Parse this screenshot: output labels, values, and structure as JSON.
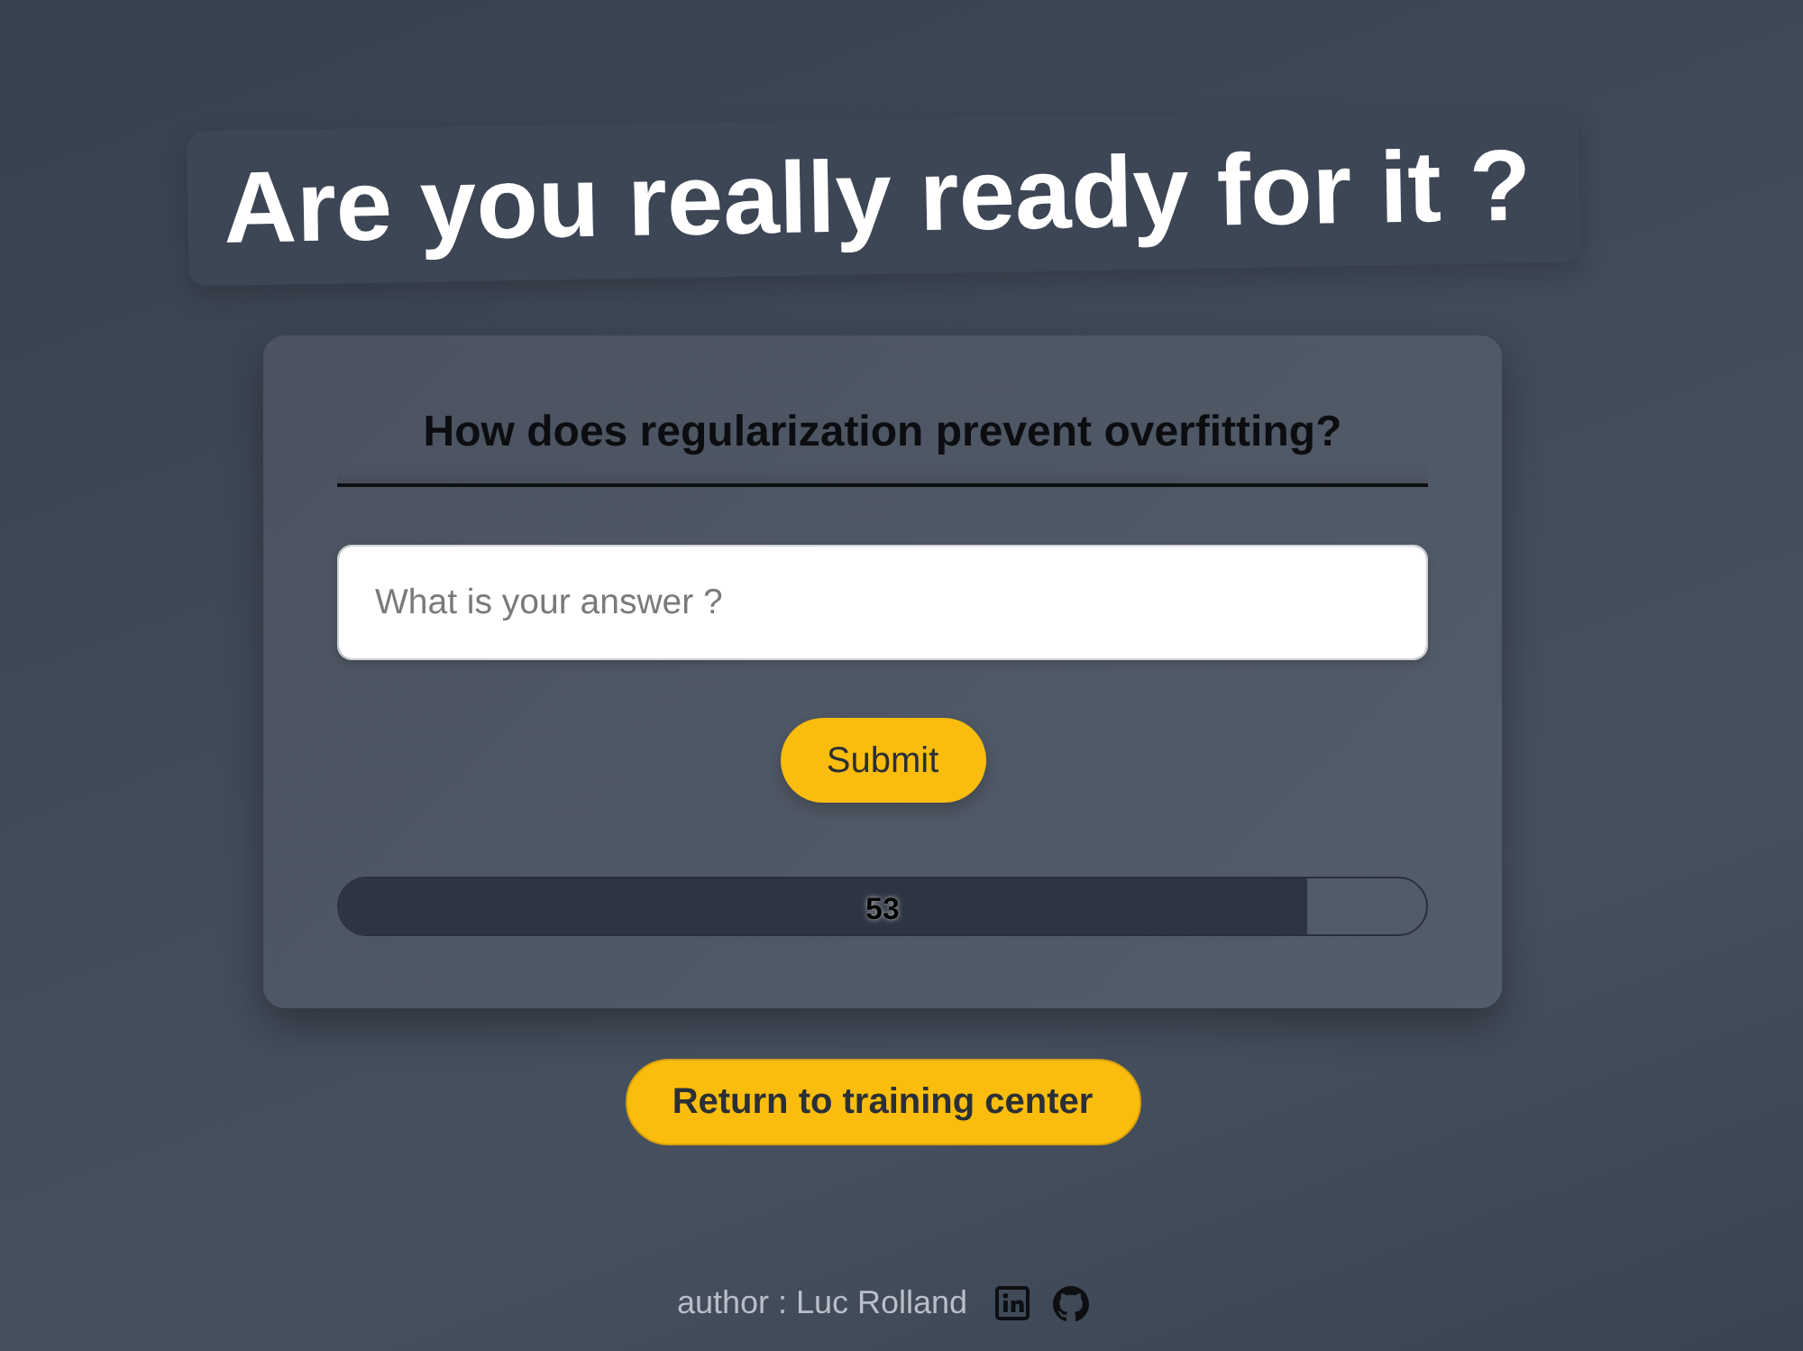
{
  "heading": {
    "text": "Are you really ready for it ?"
  },
  "quiz": {
    "question": "How does regularization prevent overfitting?",
    "answer": {
      "placeholder": "What is your answer ?"
    },
    "submit": "Submit",
    "progress": {
      "level": 0.89,
      "label": "53"
    }
  },
  "return_button": "Return to training center",
  "footer": {
    "author": "author : Luc Rolland",
    "links": [
      {
        "kind": "linkedin"
      },
      {
        "kind": "github"
      }
    ]
  }
}
